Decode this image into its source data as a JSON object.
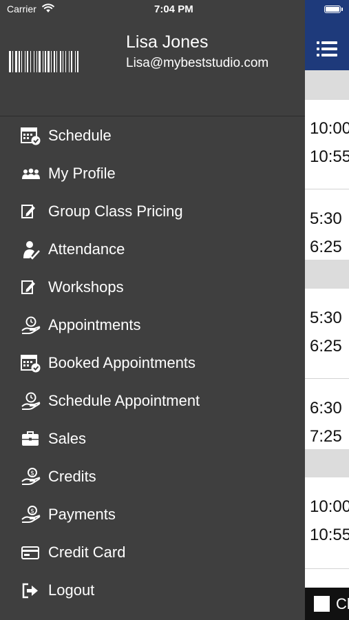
{
  "status_bar": {
    "carrier": "Carrier",
    "time": "7:04 PM"
  },
  "user": {
    "name": "Lisa Jones",
    "email": "Lisa@mybeststudio.com"
  },
  "menu": [
    {
      "label": "Schedule",
      "icon": "calendar-check-icon"
    },
    {
      "label": "My Profile",
      "icon": "people-icon"
    },
    {
      "label": "Group Class Pricing",
      "icon": "edit-note-icon"
    },
    {
      "label": "Attendance",
      "icon": "person-check-icon"
    },
    {
      "label": "Workshops",
      "icon": "edit-note-icon"
    },
    {
      "label": "Appointments",
      "icon": "hand-clock-icon"
    },
    {
      "label": "Booked Appointments",
      "icon": "calendar-check-icon"
    },
    {
      "label": "Schedule Appointment",
      "icon": "hand-clock-icon"
    },
    {
      "label": "Sales",
      "icon": "briefcase-icon"
    },
    {
      "label": "Credits",
      "icon": "hand-coin-icon"
    },
    {
      "label": "Payments",
      "icon": "hand-coin-icon"
    },
    {
      "label": "Credit Card",
      "icon": "credit-card-icon"
    },
    {
      "label": "Logout",
      "icon": "logout-icon"
    }
  ],
  "background_screen": {
    "times": [
      [
        "10:00",
        "10:55"
      ],
      [
        "5:30",
        "6:25"
      ],
      [
        "5:30",
        "6:25"
      ],
      [
        "6:30",
        "7:25"
      ],
      [
        "10:00",
        "10:55"
      ]
    ],
    "bottom_label": "Cl"
  },
  "colors": {
    "drawer_bg": "#3f3f3f",
    "nav_bar": "#1e3a7b",
    "text": "#ffffff"
  }
}
